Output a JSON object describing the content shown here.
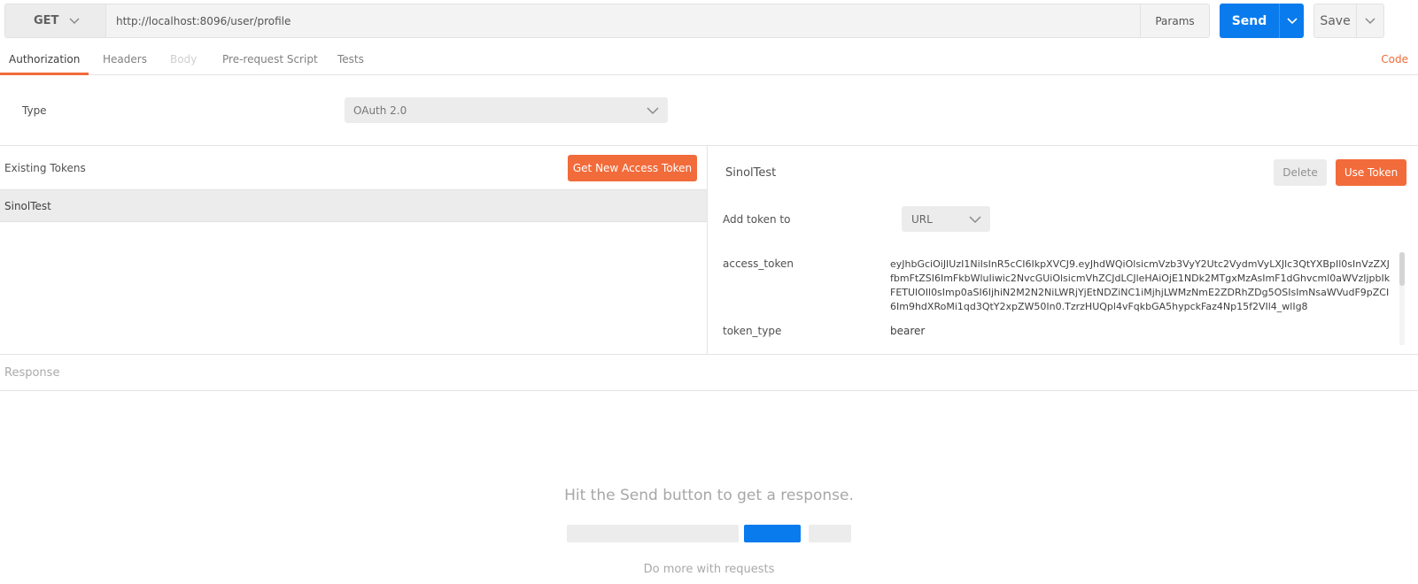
{
  "request": {
    "method": "GET",
    "url": "http://localhost:8096/user/profile",
    "params_label": "Params",
    "send_label": "Send",
    "save_label": "Save"
  },
  "tabs": [
    {
      "label": "Authorization",
      "state": "active"
    },
    {
      "label": "Headers",
      "state": "normal"
    },
    {
      "label": "Body",
      "state": "disabled"
    },
    {
      "label": "Pre-request Script",
      "state": "normal"
    },
    {
      "label": "Tests",
      "state": "normal"
    }
  ],
  "code_link": "Code",
  "auth": {
    "type_label": "Type",
    "type_value": "OAuth 2.0"
  },
  "tokens": {
    "existing_label": "Existing Tokens",
    "get_new_label": "Get New Access Token",
    "list": [
      "SinolTest"
    ],
    "selected": {
      "name": "SinolTest",
      "delete_label": "Delete",
      "use_label": "Use Token",
      "add_token_to_label": "Add token to",
      "add_token_to_value": "URL",
      "access_token_label": "access_token",
      "access_token_value": "eyJhbGciOiJIUzI1NiIsInR5cCI6IkpXVCJ9.eyJhdWQiOlsicmVzb3VyY2Utc2VydmVyLXJlc3QtYXBpIl0sInVzZXJfbmFtZSI6ImFkbWluIiwic2NvcGUiOlsicmVhZCJdLCJleHAiOjE1NDk2MTgxMzAsImF1dGhvcml0aWVzIjpbIkFETUlOIl0sImp0aSI6IjhiN2M2N2NiLWRjYjEtNDZiNC1iMjhjLWMzNmE2ZDRhZDg5OSIsImNsaWVudF9pZCI6Im9hdXRoMi1qd3QtY2xpZW50In0.TzrzHUQpl4vFqkbGA5hypckFaz4Np15f2VIl4_wlIg8",
      "token_type_label": "token_type",
      "token_type_value": "bearer"
    }
  },
  "response": {
    "label": "Response",
    "hint": "Hit the Send button to get a response.",
    "more": "Do more with requests"
  },
  "colors": {
    "accent_orange": "#f26b3a",
    "send_blue": "#097bed"
  }
}
